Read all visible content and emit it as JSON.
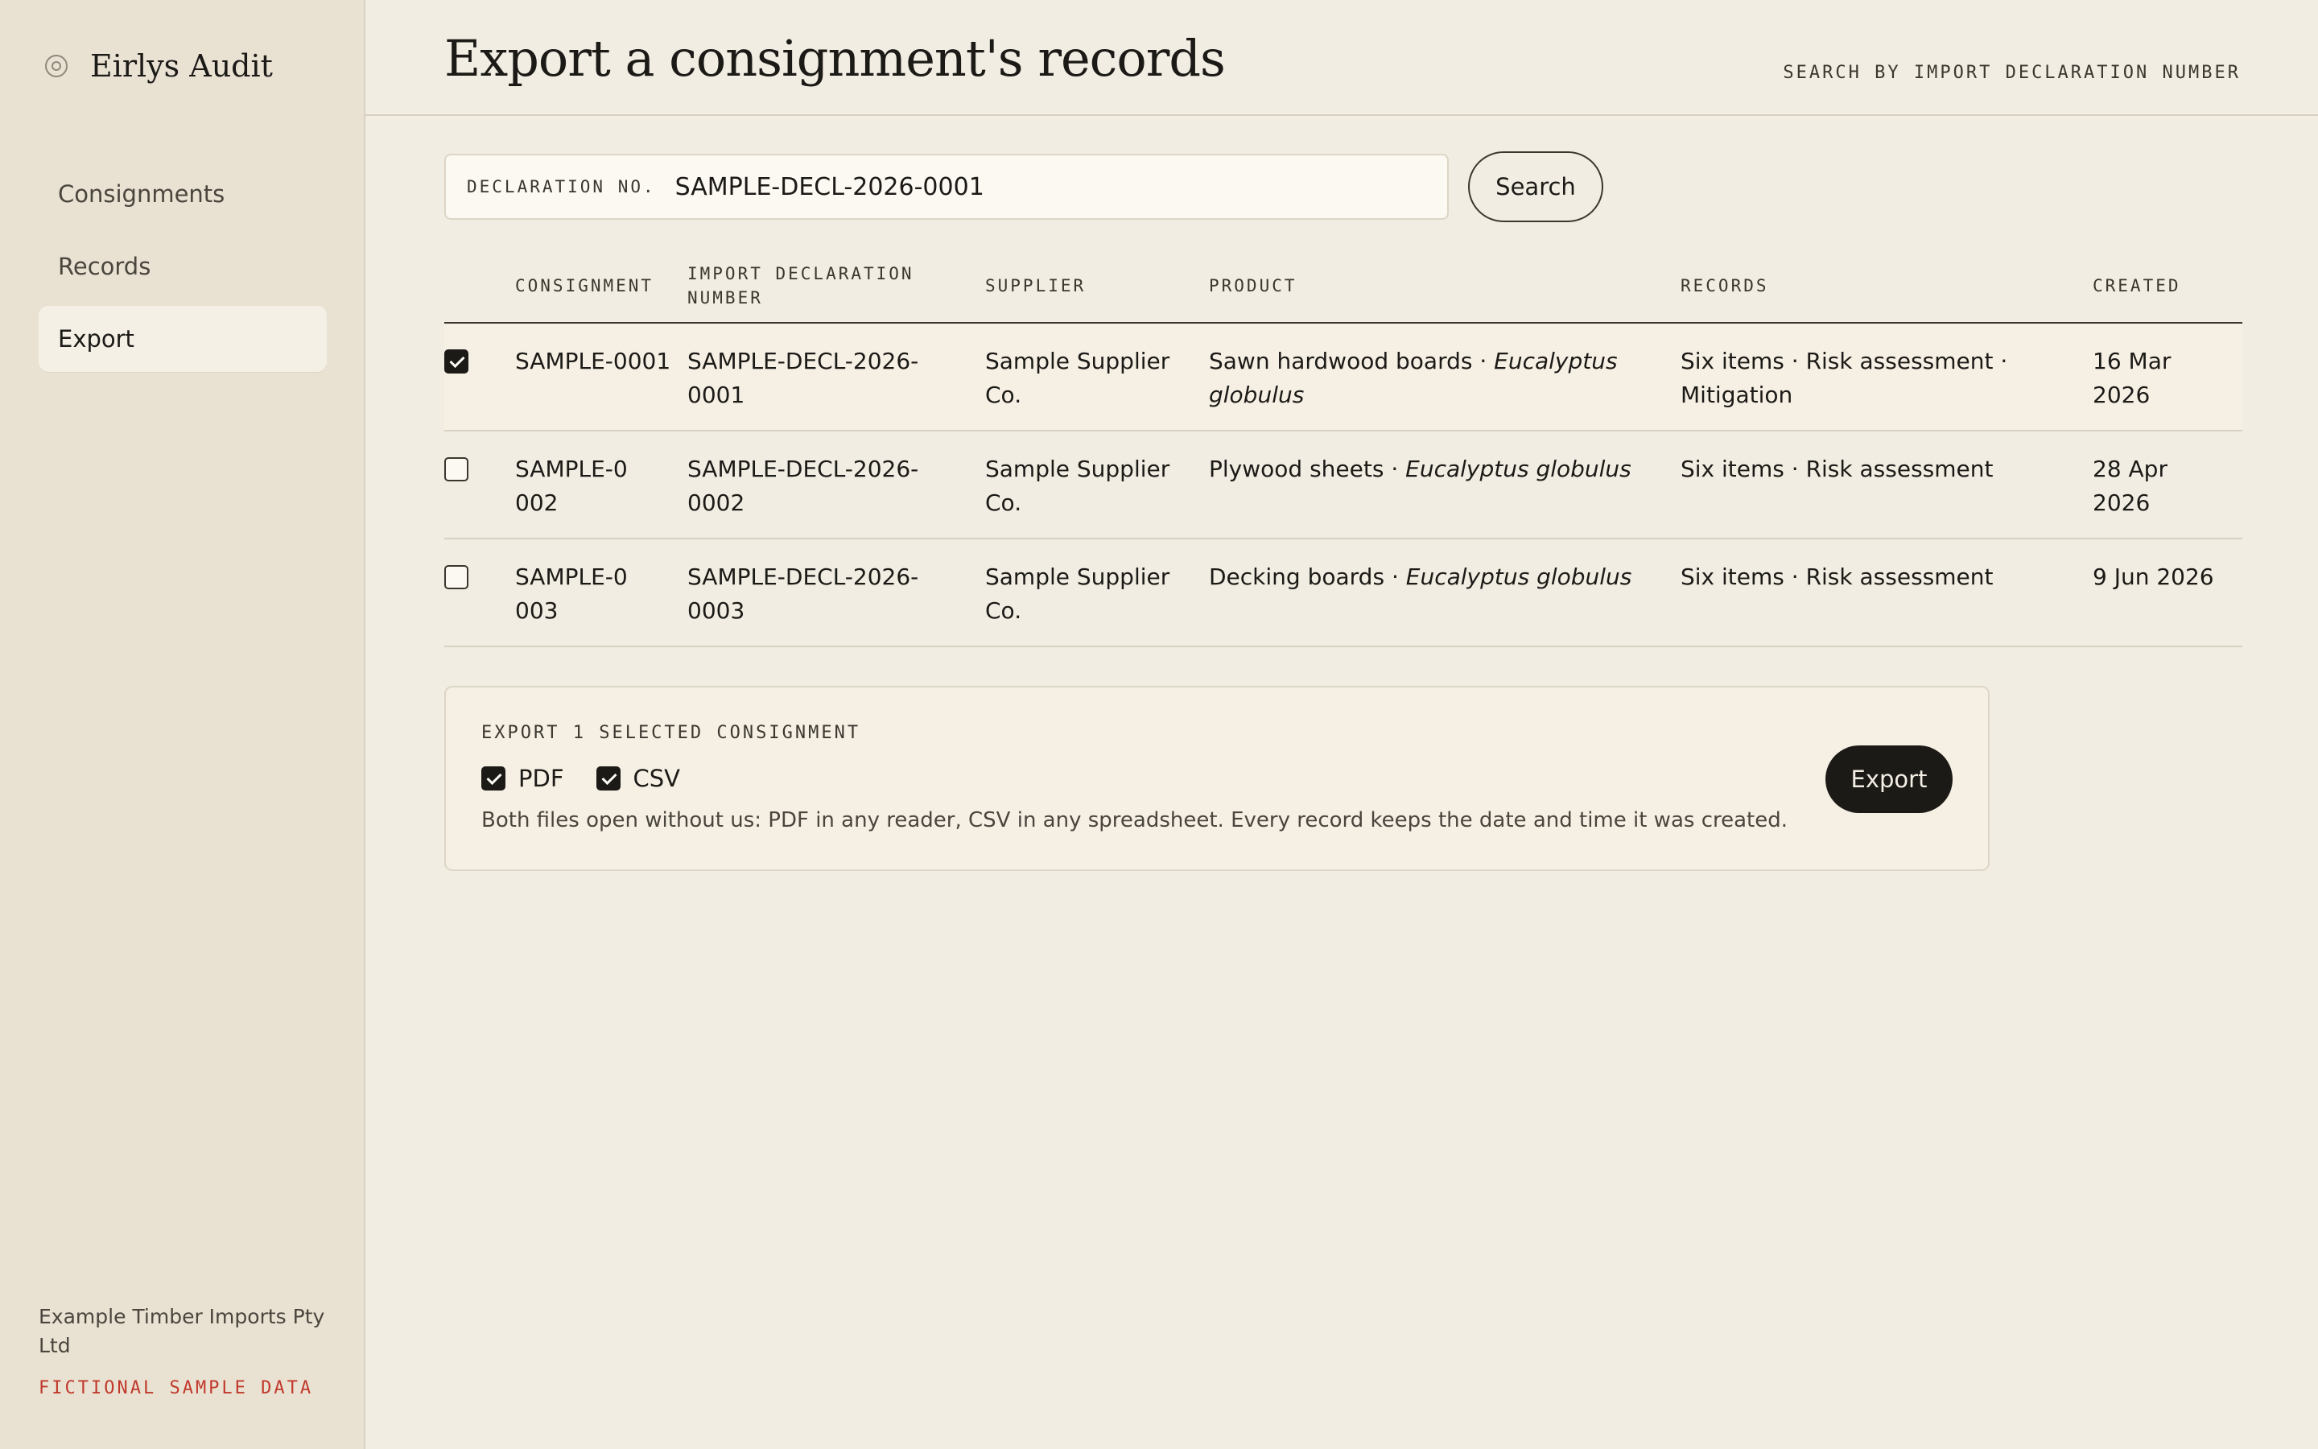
{
  "app": {
    "name": "Eirlys Audit"
  },
  "sidebar": {
    "items": [
      {
        "label": "Consignments"
      },
      {
        "label": "Records"
      },
      {
        "label": "Export"
      }
    ],
    "org_name": "Example Timber Imports Pty Ltd",
    "sample_tag": "FICTIONAL SAMPLE DATA"
  },
  "header": {
    "title": "Export a consignment's records",
    "hint": "SEARCH BY IMPORT DECLARATION NUMBER"
  },
  "search": {
    "label": "DECLARATION NO.",
    "value": "SAMPLE-DECL-2026-0001",
    "button_label": "Search"
  },
  "table": {
    "columns": [
      "CONSIGNMENT",
      "IMPORT DECLARATION NUMBER",
      "SUPPLIER",
      "PRODUCT",
      "RECORDS",
      "CREATED"
    ],
    "rows": [
      {
        "selected": true,
        "consignment": "SAMPLE-0001",
        "declaration": "SAMPLE-DECL-2026-0001",
        "supplier": "Sample Supplier Co.",
        "product": "Sawn hardwood boards · ",
        "species": "Eucalyptus globulus",
        "records": "Six items · Risk assessment · Mitigation",
        "created": "16 Mar 2026"
      },
      {
        "selected": false,
        "consignment": "SAMPLE-0002",
        "declaration": "SAMPLE-DECL-2026-0002",
        "supplier": "Sample Supplier Co.",
        "product": "Plywood sheets · ",
        "species": "Eucalyptus globulus",
        "records": "Six items · Risk assessment",
        "created": "28 Apr 2026"
      },
      {
        "selected": false,
        "consignment": "SAMPLE-0003",
        "declaration": "SAMPLE-DECL-2026-0003",
        "supplier": "Sample Supplier Co.",
        "product": "Decking boards · ",
        "species": "Eucalyptus globulus",
        "records": "Six items · Risk assessment",
        "created": "9 Jun 2026"
      }
    ]
  },
  "export": {
    "heading": "EXPORT 1 SELECTED CONSIGNMENT",
    "formats": [
      {
        "label": "PDF",
        "checked": true
      },
      {
        "label": "CSV",
        "checked": true
      }
    ],
    "note": "Both files open without us: PDF in any reader, CSV in any spreadsheet. Every record keeps the date and time it was created.",
    "button_label": "Export"
  },
  "colors": {
    "background": "#f1ede2",
    "sidebar": "#e9e2d3",
    "ink": "#1c1a17",
    "sample_tag": "#c0392b"
  }
}
